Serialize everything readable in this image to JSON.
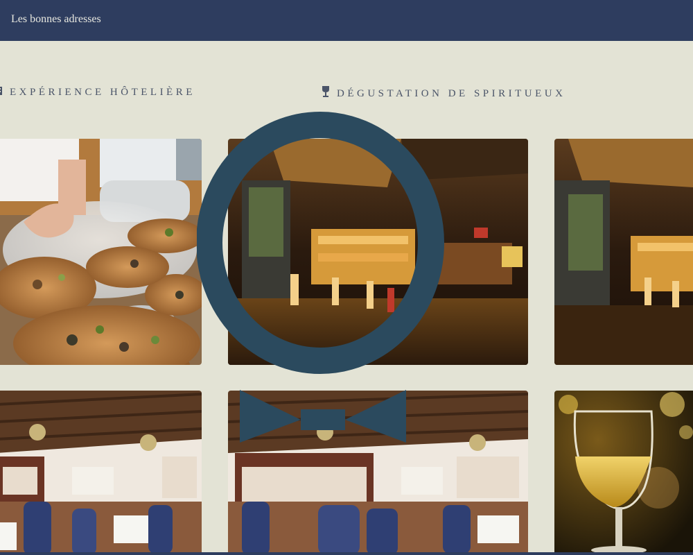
{
  "header": {
    "title": "Les bonnes adresses"
  },
  "sections": [
    {
      "label": "EXPÉRIENCE HÔTELIÈRE",
      "icon": "hotel-icon"
    },
    {
      "label": "DÉGUSTATION DE SPIRITUEUX",
      "icon": "wine-glass-icon"
    }
  ],
  "gallery": [
    {
      "name": "chef-plating-photo"
    },
    {
      "name": "bar-interior-photo"
    },
    {
      "name": "bar-interior-photo-2"
    },
    {
      "name": "dining-room-photo"
    },
    {
      "name": "dining-room-photo-2"
    },
    {
      "name": "wine-glass-photo"
    }
  ],
  "logo": {
    "name": "bow-tie-logo",
    "color": "#2b4a5e"
  },
  "colors": {
    "nav": "#2e3d5f",
    "background": "#e3e3d5",
    "accent": "#2b4a5e"
  }
}
